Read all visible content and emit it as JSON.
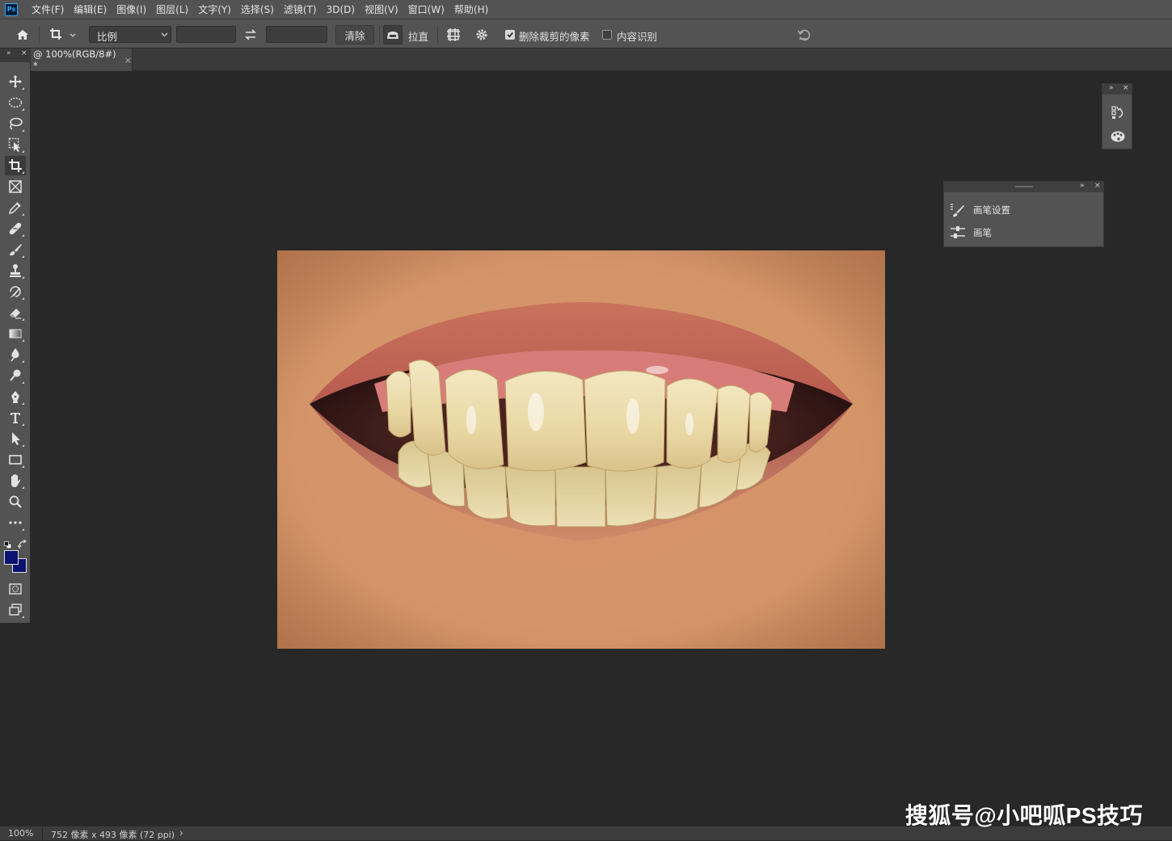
{
  "menubar": {
    "logo": "Ps",
    "items": [
      "文件(F)",
      "编辑(E)",
      "图像(I)",
      "图层(L)",
      "文字(Y)",
      "选择(S)",
      "滤镜(T)",
      "3D(D)",
      "视图(V)",
      "窗口(W)",
      "帮助(H)"
    ]
  },
  "options": {
    "ratio_select": "比例",
    "width_value": "",
    "height_value": "",
    "clear_label": "清除",
    "straighten_label": "拉直",
    "delete_cropped_label": "删除裁剪的像素",
    "delete_cropped_checked": true,
    "content_aware_label": "内容识别",
    "content_aware_checked": false
  },
  "document": {
    "tab_title": "@ 100%(RGB/8#) *",
    "tab_close": "×"
  },
  "toolbar": {
    "foreground_color": "#0b1270",
    "background_color": "#0b1270"
  },
  "panels": {
    "brush_panel": {
      "items": [
        "画笔设置",
        "画笔"
      ]
    }
  },
  "status": {
    "zoom": "100%",
    "doc_info": "752 像素 x 493 像素 (72 ppi)",
    "arrow": "›"
  },
  "watermark": "搜狐号@小吧呱PS技巧"
}
